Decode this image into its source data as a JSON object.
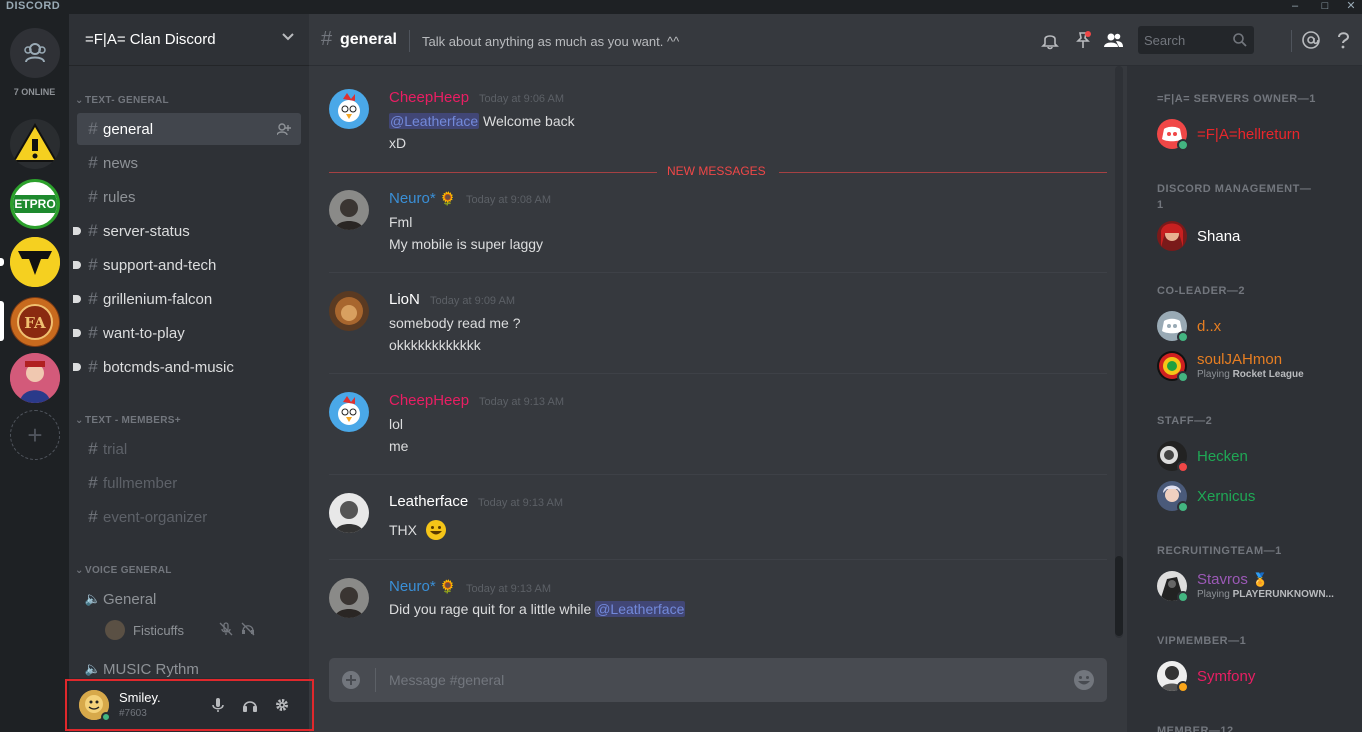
{
  "app": {
    "brand": "DISCORD"
  },
  "window_controls": [
    "–",
    "□",
    "✕"
  ],
  "guilds": {
    "online_count": "7 ONLINE",
    "etpro_label": "ETPRO",
    "add_label": "+"
  },
  "server": {
    "name": "=F|A= Clan Discord"
  },
  "categories": {
    "text_general": "TEXT- GENERAL",
    "text_members": "TEXT - MEMBERS+",
    "voice_general": "VOICE GENERAL"
  },
  "channels": [
    {
      "name": "general"
    },
    {
      "name": "news"
    },
    {
      "name": "rules"
    },
    {
      "name": "server-status"
    },
    {
      "name": "support-and-tech"
    },
    {
      "name": "grillenium-falcon"
    },
    {
      "name": "want-to-play"
    },
    {
      "name": "botcmds-and-music"
    },
    {
      "name": "trial"
    },
    {
      "name": "fullmember"
    },
    {
      "name": "event-organizer"
    }
  ],
  "voice": {
    "general": "General",
    "user": "Fisticuffs",
    "music": "MUSIC Rythm"
  },
  "user": {
    "name": "Smiley.",
    "discriminator": "#7603"
  },
  "chat_header": {
    "hash": "#",
    "channel": "general",
    "topic": "Talk about anything as much as you want. ^^",
    "search_placeholder": "Search"
  },
  "new_messages_label": "NEW MESSAGES",
  "messages": [
    {
      "author": "CheepHeep",
      "time": "Today at 9:06 AM",
      "mention": "@Leatherface",
      "text1": " Welcome back",
      "text2": "xD"
    },
    {
      "author": "Neuro*",
      "time": "Today at 9:08 AM",
      "text1": "Fml",
      "text2": "My mobile is super laggy"
    },
    {
      "author": "LioN",
      "time": "Today at 9:09 AM",
      "text1": "somebody  read me ?",
      "text2": "okkkkkkkkkkkk"
    },
    {
      "author": "CheepHeep",
      "time": "Today at 9:13 AM",
      "text1": "lol",
      "text2": "me"
    },
    {
      "author": "Leatherface",
      "time": "Today at 9:13 AM",
      "text1": "THX"
    },
    {
      "author": "Neuro*",
      "time": "Today at 9:13 AM",
      "text1": "Did you rage quit for a little while ",
      "mention": "@Leatherface"
    }
  ],
  "composer": {
    "placeholder": "Message #general"
  },
  "members": {
    "owner_cat": "=F|A= SERVERS OWNER—1",
    "mgmt_cat": "DISCORD MANAGEMENT—1",
    "coleader_cat": "CO-LEADER—2",
    "staff_cat": "STAFF—2",
    "recruit_cat": "RECRUITINGTEAM—1",
    "vip_cat": "VIPMEMBER—1",
    "member_cat": "MEMBER—12",
    "list": [
      {
        "name": "=F|A=hellreturn"
      },
      {
        "name": "Shana"
      },
      {
        "name": "d..x"
      },
      {
        "name": "soulJAHmon",
        "playing": "Playing ",
        "game": "Rocket League"
      },
      {
        "name": "Hecken"
      },
      {
        "name": "Xernicus"
      },
      {
        "name": "Stavros",
        "playing": "Playing ",
        "game": "PLAYERUNKNOWN..."
      },
      {
        "name": "Symfony"
      }
    ]
  },
  "colors": {
    "red": "#e8262b",
    "pink": "#e91e63",
    "blue": "#3a8fd6",
    "orange": "#e67e22",
    "green": "#1fa855",
    "purple": "#9b59b6",
    "online": "#43b581",
    "dnd": "#f04747",
    "idle": "#faa61a"
  }
}
